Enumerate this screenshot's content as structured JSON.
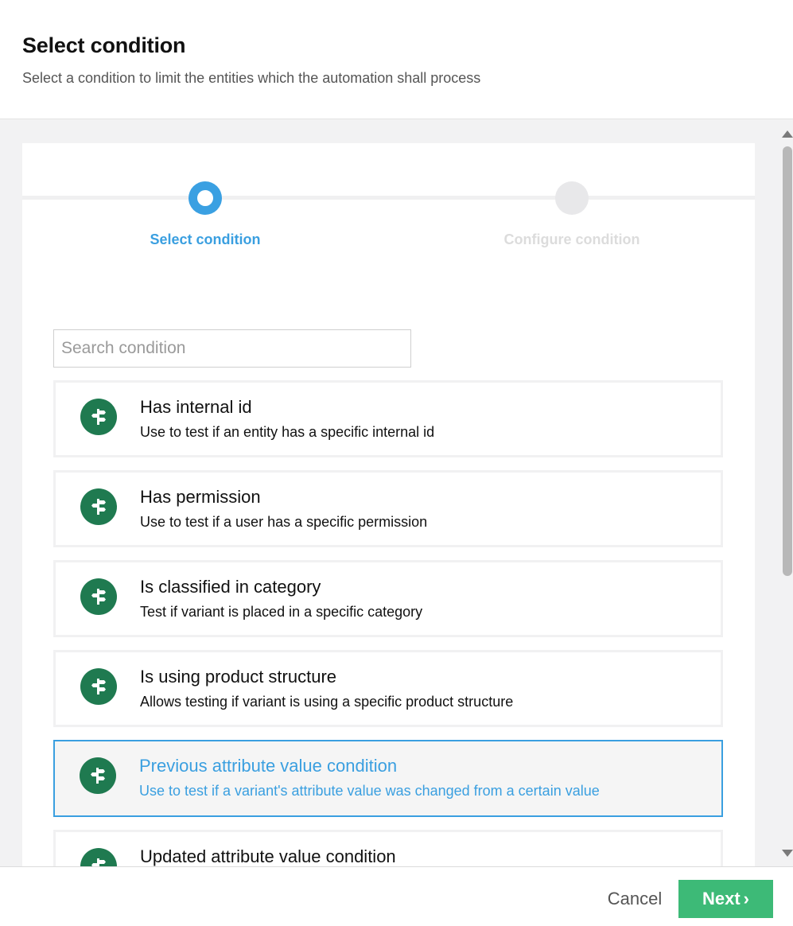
{
  "dialog": {
    "title": "Select condition",
    "subtitle": "Select a condition to limit the entities which the automation shall process"
  },
  "stepper": {
    "steps": [
      {
        "label": "Select condition",
        "state": "active"
      },
      {
        "label": "Configure condition",
        "state": "inactive"
      }
    ]
  },
  "search": {
    "placeholder": "Search condition",
    "value": ""
  },
  "conditions": [
    {
      "title": "Has internal id",
      "description": "Use to test if an entity has a specific internal id",
      "icon": "signpost-icon",
      "selected": false
    },
    {
      "title": "Has permission",
      "description": "Use to test if a user has a specific permission",
      "icon": "signpost-icon",
      "selected": false
    },
    {
      "title": "Is classified in category",
      "description": "Test if variant is placed in a specific category",
      "icon": "signpost-icon",
      "selected": false
    },
    {
      "title": "Is using product structure",
      "description": "Allows testing if variant is using a specific product structure",
      "icon": "signpost-icon",
      "selected": false
    },
    {
      "title": "Previous attribute value condition",
      "description": "Use to test if a variant's attribute value was changed from a certain value",
      "icon": "signpost-icon",
      "selected": true
    },
    {
      "title": "Updated attribute value condition",
      "description": "",
      "icon": "signpost-icon",
      "selected": false
    }
  ],
  "footer": {
    "cancel_label": "Cancel",
    "next_label": "Next",
    "next_icon": "chevron-right-icon"
  },
  "colors": {
    "accent": "#3a9fe0",
    "icon_bg": "#1f7a50",
    "next_button": "#3dba77"
  }
}
